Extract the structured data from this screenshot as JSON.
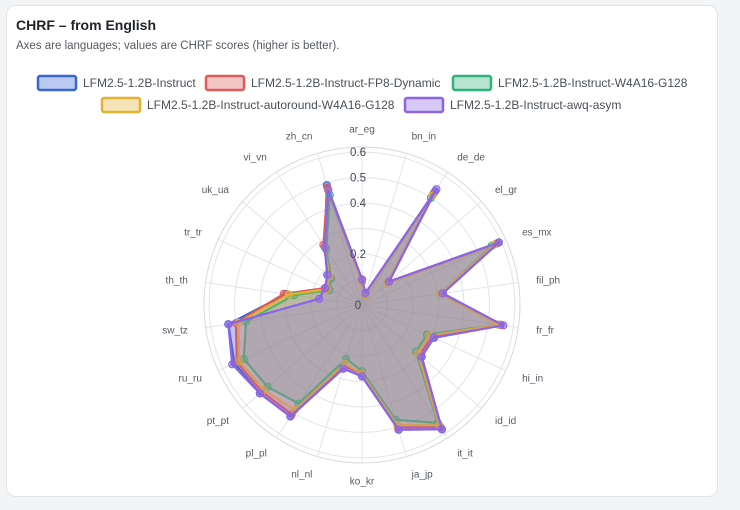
{
  "card": {
    "title": "CHRF – from English",
    "subtitle": "Axes are languages; values are CHRF scores (higher is better)."
  },
  "chart_data": {
    "type": "radar",
    "categories": [
      "ar_eg",
      "bn_in",
      "de_de",
      "el_gr",
      "es_mx",
      "fil_ph",
      "fr_fr",
      "hi_in",
      "id_id",
      "it_it",
      "ja_jp",
      "ko_kr",
      "nl_nl",
      "pl_pl",
      "pt_pt",
      "ru_ru",
      "sw_tz",
      "th_th",
      "tr_tr",
      "uk_ua",
      "vi_vn",
      "zh_cn"
    ],
    "radial_ticks": [
      "0",
      "0.2",
      "0.4",
      "0.5",
      "0.6"
    ],
    "radial_range": [
      0,
      0.62
    ],
    "legend_position": "top",
    "series": [
      {
        "name": "LFM2.5-1.2B-Instruct",
        "color": "#3a66d4",
        "values": [
          0.1,
          0.04,
          0.53,
          0.14,
          0.59,
          0.32,
          0.55,
          0.31,
          0.31,
          0.58,
          0.51,
          0.28,
          0.26,
          0.52,
          0.53,
          0.55,
          0.53,
          0.3,
          0.15,
          0.18,
          0.27,
          0.49
        ]
      },
      {
        "name": "LFM2.5-1.2B-Instruct-FP8-Dynamic",
        "color": "#e05a5a",
        "values": [
          0.1,
          0.04,
          0.52,
          0.14,
          0.58,
          0.32,
          0.55,
          0.3,
          0.3,
          0.57,
          0.5,
          0.27,
          0.25,
          0.51,
          0.52,
          0.54,
          0.5,
          0.31,
          0.16,
          0.17,
          0.28,
          0.48
        ]
      },
      {
        "name": "LFM2.5-1.2B-Instruct-W4A16-G128",
        "color": "#2fb37c",
        "values": [
          0.09,
          0.04,
          0.5,
          0.13,
          0.56,
          0.31,
          0.54,
          0.28,
          0.28,
          0.55,
          0.47,
          0.26,
          0.22,
          0.46,
          0.49,
          0.51,
          0.46,
          0.27,
          0.14,
          0.16,
          0.26,
          0.45
        ]
      },
      {
        "name": "LFM2.5-1.2B-Instruct-autoround-W4A16-G128",
        "color": "#e3b130",
        "values": [
          0.09,
          0.04,
          0.51,
          0.13,
          0.57,
          0.31,
          0.54,
          0.29,
          0.29,
          0.56,
          0.49,
          0.27,
          0.24,
          0.49,
          0.51,
          0.53,
          0.49,
          0.29,
          0.15,
          0.17,
          0.27,
          0.47
        ]
      },
      {
        "name": "LFM2.5-1.2B-Instruct-awq-asym",
        "color": "#8b64e8",
        "values": [
          0.1,
          0.05,
          0.54,
          0.14,
          0.59,
          0.32,
          0.56,
          0.31,
          0.31,
          0.58,
          0.51,
          0.28,
          0.26,
          0.52,
          0.53,
          0.56,
          0.53,
          0.17,
          0.16,
          0.18,
          0.27,
          0.47
        ]
      }
    ]
  }
}
